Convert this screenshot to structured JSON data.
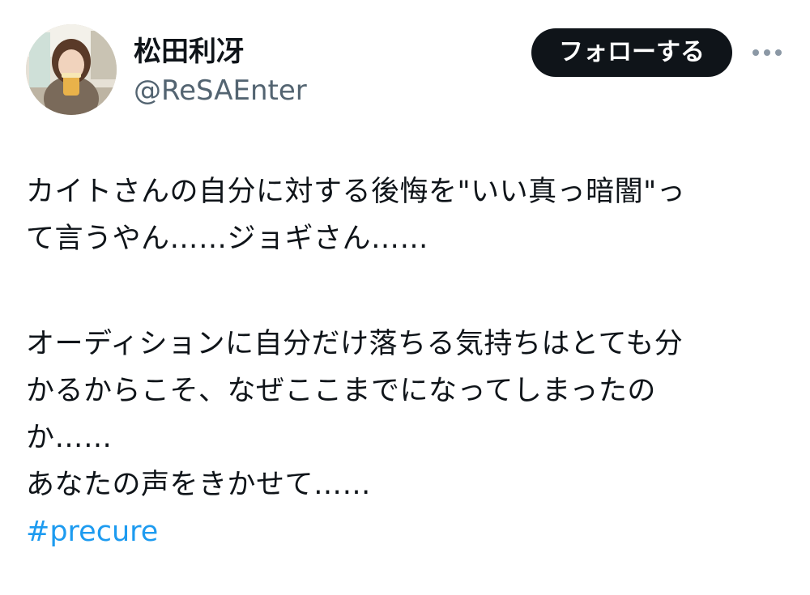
{
  "user": {
    "display_name": "松田利冴",
    "handle": "@ReSAEnter",
    "avatar_icon": "profile-photo"
  },
  "actions": {
    "follow_label": "フォローする",
    "more_icon": "more-horizontal-icon"
  },
  "tweet": {
    "lines": [
      "カイトさんの自分に対する後悔を\"いい真っ暗闇\"っ",
      "て言うやん……ジョギさん……",
      "",
      "オーディションに自分だけ落ちる気持ちはとても分",
      "かるからこそ、なぜここまでになってしまったの",
      "か……",
      "あなたの声をきかせて……"
    ],
    "hashtag": "#precure"
  },
  "colors": {
    "text": "#0f1419",
    "secondary": "#536471",
    "link": "#1d9bf0",
    "button_bg": "#0f1419",
    "button_text": "#ffffff"
  }
}
